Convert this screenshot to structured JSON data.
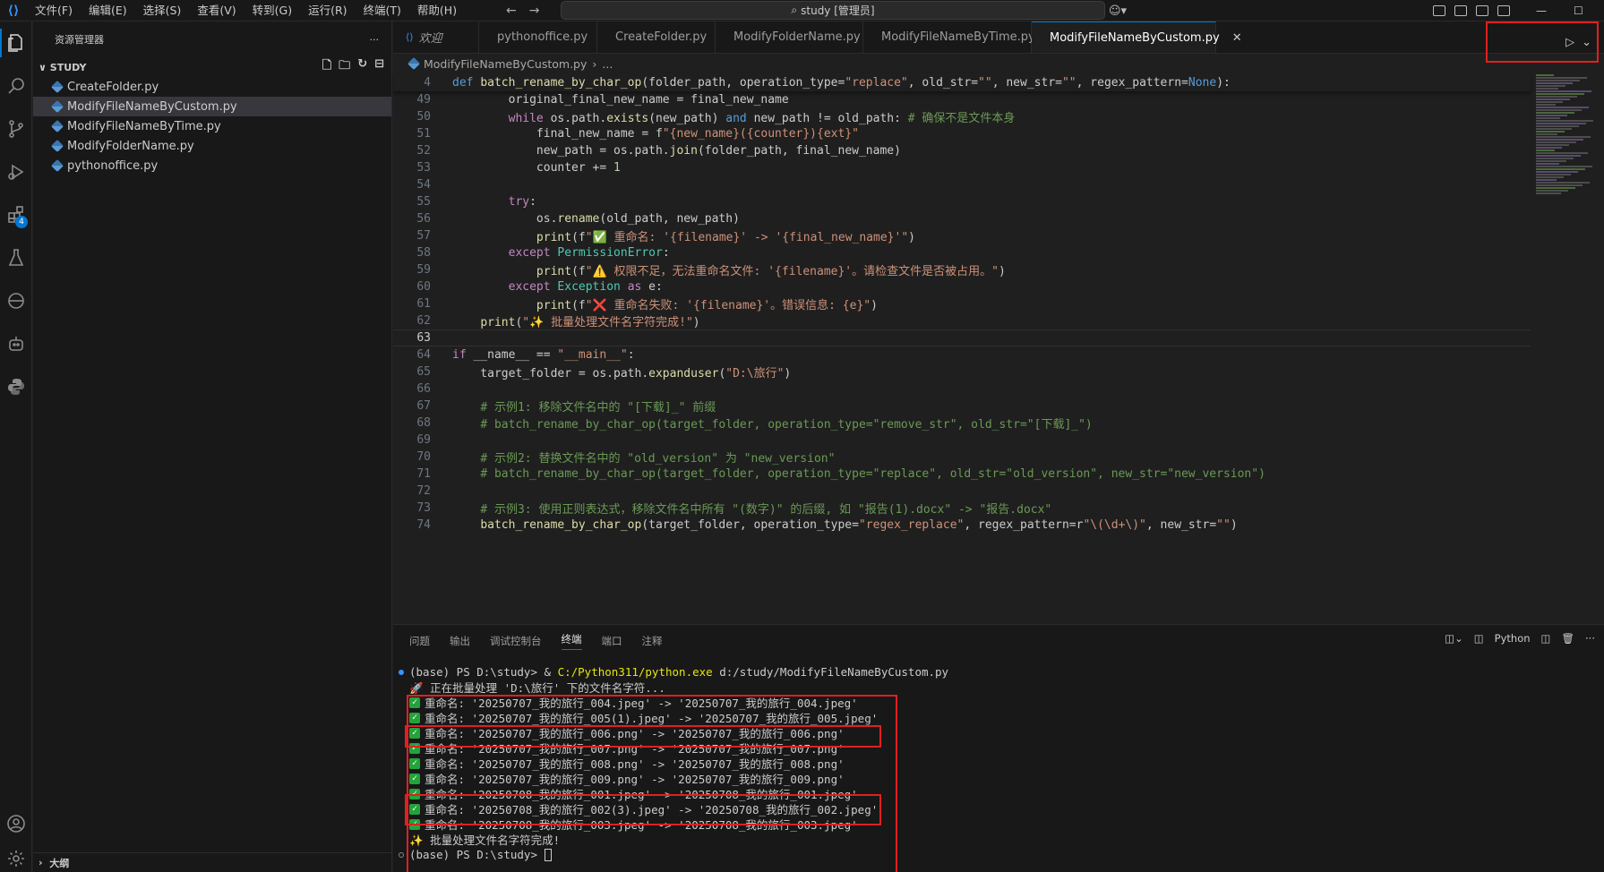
{
  "menu": [
    "文件(F)",
    "编辑(E)",
    "选择(S)",
    "查看(V)",
    "转到(G)",
    "运行(R)",
    "终端(T)",
    "帮助(H)"
  ],
  "command_center": "study [管理员]",
  "sidebar": {
    "title": "资源管理器",
    "section": "STUDY",
    "files": [
      "CreateFolder.py",
      "ModifyFileNameByCustom.py",
      "ModifyFileNameByTime.py",
      "ModifyFolderName.py",
      "pythonoffice.py"
    ],
    "outline": "大纲"
  },
  "activity": {
    "extensions_badge": "4"
  },
  "tabs": [
    "欢迎",
    "pythonoffice.py",
    "CreateFolder.py",
    "ModifyFolderName.py",
    "ModifyFileNameByTime.py",
    "ModifyFileNameByCustom.py"
  ],
  "breadcrumb": {
    "file": "ModifyFileNameByCustom.py",
    "more": "..."
  },
  "editor": {
    "sticky_line_number": "4",
    "sticky_code": "def batch_rename_by_char_op(folder_path, operation_type=\"replace\", old_str=\"\", new_str=\"\", regex_pattern=None):",
    "lines": [
      {
        "n": "49",
        "code": "        original_final_new_name = final_new_name"
      },
      {
        "n": "50",
        "code": "        while os.path.exists(new_path) and new_path != old_path: # 确保不是文件本身"
      },
      {
        "n": "51",
        "code": "            final_new_name = f\"{new_name}({counter}){ext}\""
      },
      {
        "n": "52",
        "code": "            new_path = os.path.join(folder_path, final_new_name)"
      },
      {
        "n": "53",
        "code": "            counter += 1"
      },
      {
        "n": "54",
        "code": ""
      },
      {
        "n": "55",
        "code": "        try:"
      },
      {
        "n": "56",
        "code": "            os.rename(old_path, new_path)"
      },
      {
        "n": "57",
        "code": "            print(f\"✅ 重命名: '{filename}' -> '{final_new_name}'\")"
      },
      {
        "n": "58",
        "code": "        except PermissionError:"
      },
      {
        "n": "59",
        "code": "            print(f\"⚠️ 权限不足，无法重命名文件: '{filename}'。请检查文件是否被占用。\")"
      },
      {
        "n": "60",
        "code": "        except Exception as e:"
      },
      {
        "n": "61",
        "code": "            print(f\"❌ 重命名失败: '{filename}'。错误信息: {e}\")"
      },
      {
        "n": "62",
        "code": "    print(\"✨ 批量处理文件名字符完成!\")"
      },
      {
        "n": "63",
        "code": ""
      },
      {
        "n": "64",
        "code": "if __name__ == \"__main__\":"
      },
      {
        "n": "65",
        "code": "    target_folder = os.path.expanduser(\"D:\\旅行\")"
      },
      {
        "n": "66",
        "code": ""
      },
      {
        "n": "67",
        "code": "    # 示例1: 移除文件名中的 \"[下载]_\" 前缀"
      },
      {
        "n": "68",
        "code": "    # batch_rename_by_char_op(target_folder, operation_type=\"remove_str\", old_str=\"[下载]_\")"
      },
      {
        "n": "69",
        "code": ""
      },
      {
        "n": "70",
        "code": "    # 示例2: 替换文件名中的 \"old_version\" 为 \"new_version\""
      },
      {
        "n": "71",
        "code": "    # batch_rename_by_char_op(target_folder, operation_type=\"replace\", old_str=\"old_version\", new_str=\"new_version\")"
      },
      {
        "n": "72",
        "code": ""
      },
      {
        "n": "73",
        "code": "    # 示例3: 使用正则表达式，移除文件名中所有 \"(数字)\" 的后缀, 如 \"报告(1).docx\" -> \"报告.docx\""
      },
      {
        "n": "74",
        "code": "    batch_rename_by_char_op(target_folder, operation_type=\"regex_replace\", regex_pattern=r\"\\(\\d+\\)\", new_str=\"\")"
      }
    ]
  },
  "panel": {
    "tabs": [
      "问题",
      "输出",
      "调试控制台",
      "终端",
      "端口",
      "注释"
    ],
    "active_tab": "终端",
    "shell_label": "Python",
    "terminal": {
      "prompt_line": "(base) PS D:\\study> & C:/Python311/python.exe d:/study/ModifyFileNameByCustom.py",
      "processing": "🚀 正在批量处理 'D:\\旅行' 下的文件名字符...",
      "renames": [
        "重命名: '20250707_我的旅行_004.jpeg' -> '20250707_我的旅行_004.jpeg'",
        "重命名: '20250707_我的旅行_005(1).jpeg' -> '20250707_我的旅行_005.jpeg'",
        "重命名: '20250707_我的旅行_006.png' -> '20250707_我的旅行_006.png'",
        "重命名: '20250707_我的旅行_007.png' -> '20250707_我的旅行_007.png'",
        "重命名: '20250707_我的旅行_008.png' -> '20250707_我的旅行_008.png'",
        "重命名: '20250707_我的旅行_009.png' -> '20250707_我的旅行_009.png'",
        "重命名: '20250708_我的旅行_001.jpeg' -> '20250708_我的旅行_001.jpeg'",
        "重命名: '20250708_我的旅行_002(3).jpeg' -> '20250708_我的旅行_002.jpeg'",
        "重命名: '20250708_我的旅行_003.jpeg' -> '20250708_我的旅行_003.jpeg'"
      ],
      "done": "✨ 批量处理文件名字符完成!",
      "final_prompt": "(base) PS D:\\study> "
    }
  }
}
